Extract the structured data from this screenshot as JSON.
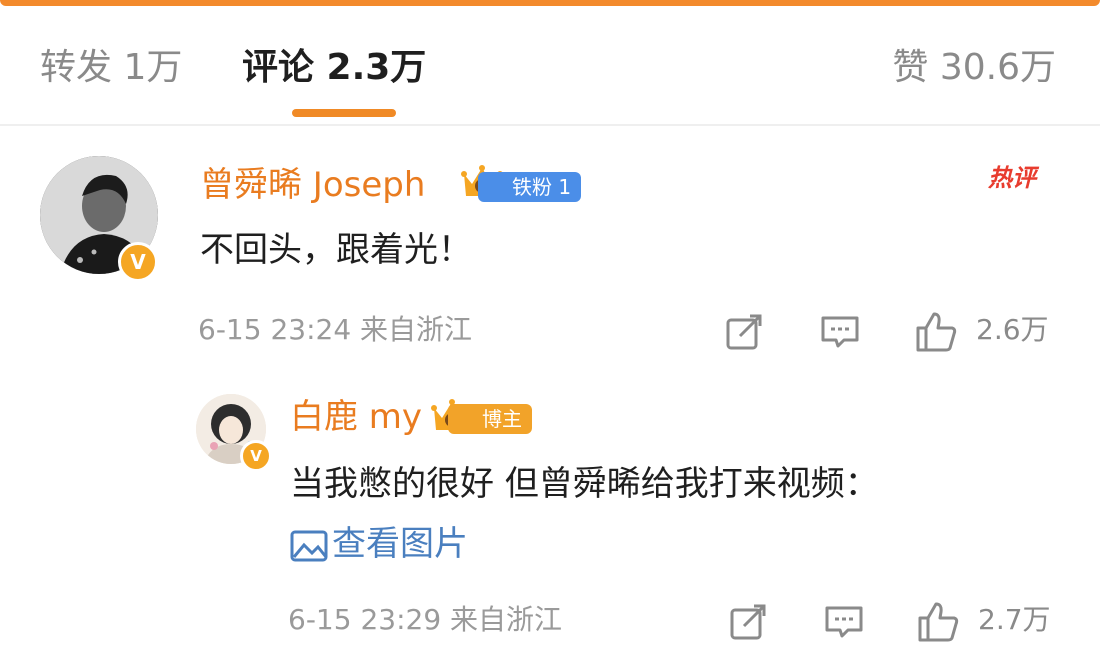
{
  "tabs": {
    "repost": "转发 1万",
    "comments": "评论 2.3万",
    "likes": "赞 30.6万"
  },
  "comments": [
    {
      "username": "曾舜晞 Joseph",
      "badge": "铁粉 1",
      "badge_color": "#4b8ee8",
      "hot_label": "热评",
      "text": "不回头，跟着光！",
      "meta": "6-15 23:24 来自浙江",
      "like_count": "2.6万",
      "icons": [
        "repost-icon",
        "comment-icon",
        "like-icon"
      ]
    },
    {
      "username": "白鹿 my",
      "badge": "博主",
      "badge_color": "#f2a329",
      "text": "当我憋的很好 但曾舜晞给我打来视频：",
      "view_image": "查看图片",
      "meta": "6-15 23:29 来自浙江",
      "like_count": "2.7万",
      "icons": [
        "repost-icon",
        "comment-icon",
        "like-icon"
      ]
    }
  ],
  "colors": {
    "accent": "#f08a26",
    "username": "#e97c20",
    "link": "#4a7fbf",
    "hot": "#e83c2e"
  }
}
